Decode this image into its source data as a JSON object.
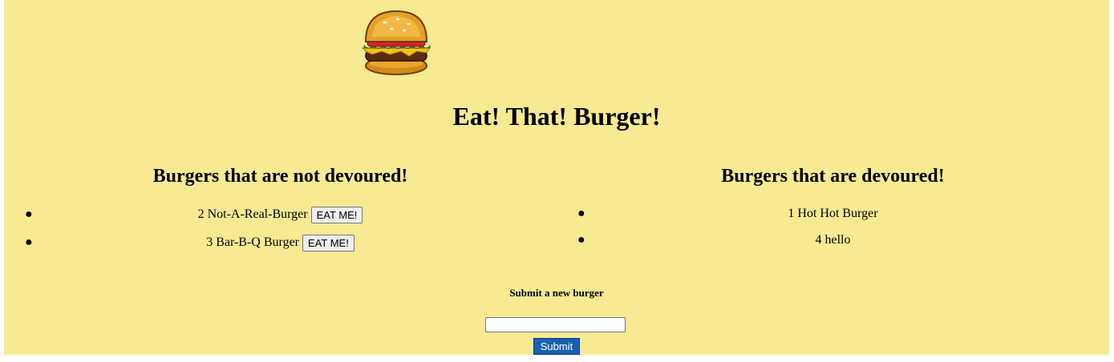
{
  "header": {
    "logo_icon": "burger-icon",
    "title": "Eat! That! Burger!"
  },
  "not_devoured": {
    "heading": "Burgers that are not devoured!",
    "items": [
      {
        "text": "2 Not-A-Real-Burger",
        "button_label": "EAT ME!"
      },
      {
        "text": "3 Bar-B-Q Burger",
        "button_label": "EAT ME!"
      }
    ]
  },
  "devoured": {
    "heading": "Burgers that are devoured!",
    "items": [
      {
        "text": "1 Hot Hot Burger"
      },
      {
        "text": "4 hello"
      }
    ]
  },
  "form": {
    "label": "Submit a new burger",
    "input_value": "",
    "input_placeholder": "",
    "submit_label": "Submit"
  },
  "colors": {
    "background": "#f7ea93",
    "submit_button": "#1a5fb4"
  }
}
